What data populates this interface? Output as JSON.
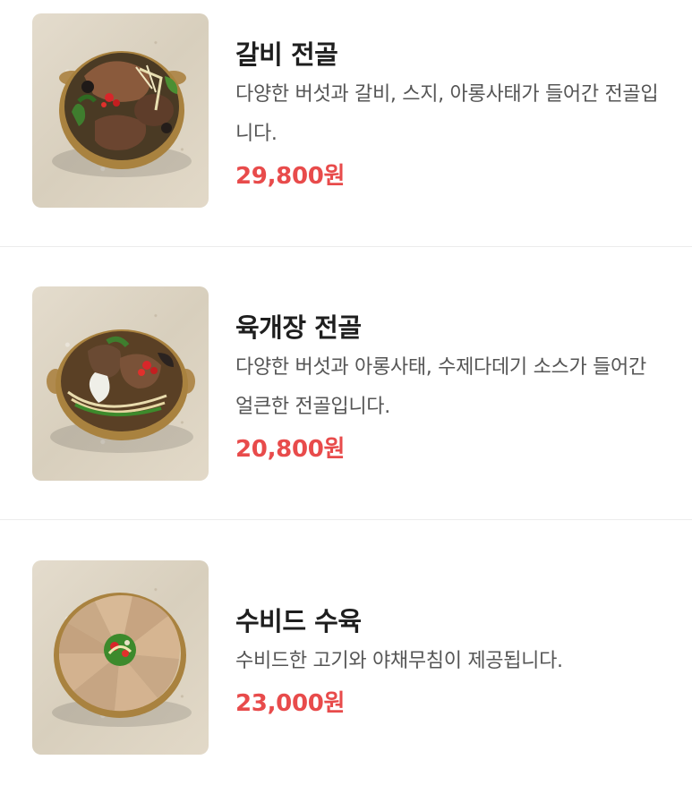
{
  "menu": {
    "items": [
      {
        "name": "갈비 전골",
        "description": "다양한 버섯과 갈비, 스지, 아롱사태가 들어간 전골입니다.",
        "price": "29,800원",
        "image": "galbi-jeongol-photo"
      },
      {
        "name": "육개장 전골",
        "description": "다양한 버섯과 아롱사태, 수제다데기 소스가 들어간 얼큰한 전골입니다.",
        "price": "20,800원",
        "image": "yukgaejang-jeongol-photo"
      },
      {
        "name": "수비드 수육",
        "description": "수비드한 고기와 야채무침이 제공됩니다.",
        "price": "23,000원",
        "image": "sous-vide-suyuk-photo"
      }
    ]
  },
  "colors": {
    "price": "#e84b4b",
    "name": "#1e1e1e",
    "description": "#555555",
    "divider": "#ececec"
  }
}
